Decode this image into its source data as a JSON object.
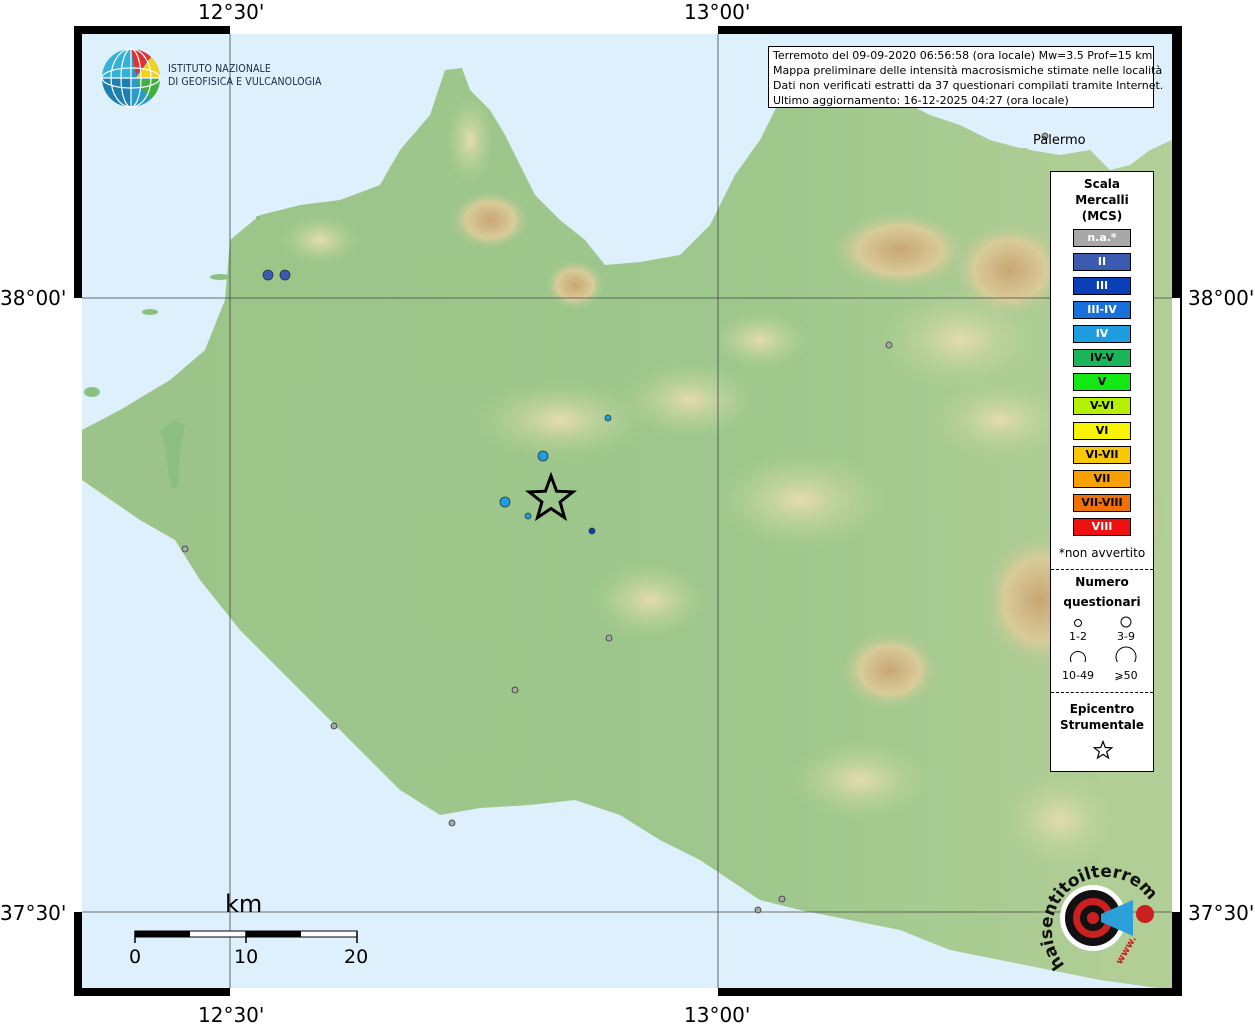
{
  "coords": {
    "top_left": "12°30'",
    "top_right": "13°00'",
    "bottom_left": "12°30'",
    "bottom_right": "13°00'",
    "left_top": "38°00'",
    "left_bottom": "37°30'",
    "right_top": "38°00'",
    "right_bottom": "37°30'"
  },
  "info": {
    "line1": "Terremoto del 09-09-2020 06:56:58 (ora locale) Mw=3.5 Prof=15 km",
    "line2": "Mappa preliminare delle intensità macrosismiche stimate nelle località",
    "line3": "Dati non verificati estratti da 37 questionari compilati tramite Internet.",
    "line4": "Ultimo aggiornamento: 16-12-2025 04:27 (ora locale)"
  },
  "logo": {
    "line1": "ISTITUTO NAZIONALE",
    "line2": "DI GEOFISICA E VULCANOLOGIA"
  },
  "city": {
    "palermo": "Palermo"
  },
  "legend": {
    "title1": "Scala",
    "title2": "Mercalli",
    "title3": "(MCS)",
    "classes": [
      {
        "label": "n.a.*",
        "color": "#a8a8a8",
        "text": "#ffffff"
      },
      {
        "label": "II",
        "color": "#3a5bb0",
        "text": "#ffffff"
      },
      {
        "label": "III",
        "color": "#0a3fb8",
        "text": "#ffffff"
      },
      {
        "label": "III-IV",
        "color": "#1a6fd8",
        "text": "#ffffff"
      },
      {
        "label": "IV",
        "color": "#1e9ee0",
        "text": "#ffffff"
      },
      {
        "label": "IV-V",
        "color": "#1ab45a",
        "text": "#000000"
      },
      {
        "label": "V",
        "color": "#14e814",
        "text": "#000000"
      },
      {
        "label": "V-VI",
        "color": "#b4f000",
        "text": "#000000"
      },
      {
        "label": "VI",
        "color": "#f8f400",
        "text": "#000000"
      },
      {
        "label": "VI-VII",
        "color": "#f8c800",
        "text": "#000000"
      },
      {
        "label": "VII",
        "color": "#f8a000",
        "text": "#000000"
      },
      {
        "label": "VII-VIII",
        "color": "#f07000",
        "text": "#000000"
      },
      {
        "label": "VIII",
        "color": "#f01010",
        "text": "#ffffff"
      }
    ],
    "not_felt": "*non avvertito",
    "count_title1": "Numero",
    "count_title2": "questionari",
    "count_1": "1-2",
    "count_2": "3-9",
    "count_3": "10-49",
    "count_4": "⩾50",
    "epi_title1": "Epicentro",
    "epi_title2": "Strumentale"
  },
  "scale": {
    "unit": "km",
    "n0": "0",
    "n10": "10",
    "n20": "20"
  },
  "brand": {
    "text": "haisentitoilterremoto.it",
    "url": "www."
  },
  "points": [
    {
      "name": "point-blue-1",
      "intensity": "II"
    },
    {
      "name": "point-blue-2",
      "intensity": "II"
    },
    {
      "name": "point-grey-1",
      "intensity": "n.a.*"
    },
    {
      "name": "point-iv-1",
      "intensity": "IV"
    },
    {
      "name": "point-iv-2",
      "intensity": "IV"
    },
    {
      "name": "point-iv-3",
      "intensity": "IV"
    },
    {
      "name": "point-iv-4",
      "intensity": "IV"
    },
    {
      "name": "point-iii-1",
      "intensity": "III"
    },
    {
      "name": "point-grey-2",
      "intensity": "n.a.*"
    },
    {
      "name": "point-grey-3",
      "intensity": "n.a.*"
    },
    {
      "name": "point-grey-4",
      "intensity": "n.a.*"
    },
    {
      "name": "point-grey-5",
      "intensity": "n.a.*"
    },
    {
      "name": "point-grey-6",
      "intensity": "n.a.*"
    },
    {
      "name": "point-grey-7",
      "intensity": "n.a.*"
    },
    {
      "name": "point-grey-8",
      "intensity": "n.a.*"
    },
    {
      "name": "point-grey-9",
      "intensity": "n.a.*"
    },
    {
      "name": "point-grey-10",
      "intensity": "n.a.*"
    }
  ]
}
